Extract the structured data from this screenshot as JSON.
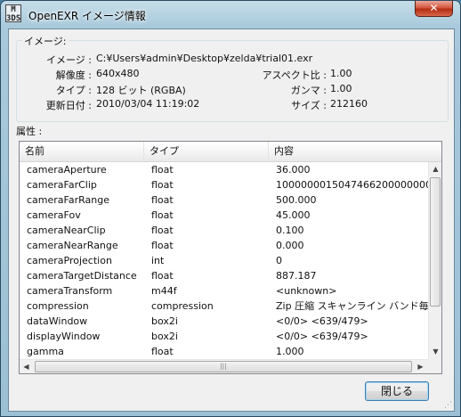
{
  "window": {
    "title": "OpenEXR イメージ情報",
    "icon_text": "M\n3DS",
    "close_glyph": "✕"
  },
  "image_group": {
    "legend": "イメージ:",
    "image_label": "イメージ :",
    "image_value": "C:¥Users¥admin¥Desktop¥zelda¥trial01.exr",
    "resolution_label": "解像度 :",
    "resolution_value": "640x480",
    "type_label": "タイプ :",
    "type_value": "128 ビット (RGBA)",
    "updated_label": "更新日付 :",
    "updated_value": "2010/03/04 11:19:02",
    "aspect_label": "アスペクト比 :",
    "aspect_value": "1.00",
    "gamma_label": "ガンマ :",
    "gamma_value": "1.00",
    "size_label": "サイズ :",
    "size_value": "212160"
  },
  "attributes": {
    "label": "属性 :",
    "columns": [
      "名前",
      "タイプ",
      "内容"
    ],
    "rows": [
      [
        "cameraAperture",
        "float",
        "36.000"
      ],
      [
        "cameraFarClip",
        "float",
        "10000000150474662000000000..."
      ],
      [
        "cameraFarRange",
        "float",
        "500.000"
      ],
      [
        "cameraFov",
        "float",
        "45.000"
      ],
      [
        "cameraNearClip",
        "float",
        "0.100"
      ],
      [
        "cameraNearRange",
        "float",
        "0.000"
      ],
      [
        "cameraProjection",
        "int",
        "0"
      ],
      [
        "cameraTargetDistance",
        "float",
        "887.187"
      ],
      [
        "cameraTransform",
        "m44f",
        "<unknown>"
      ],
      [
        "compression",
        "compression",
        "Zip 圧縮 スキャンライン バンド毎 (..."
      ],
      [
        "dataWindow",
        "box2i",
        "<0/0> <639/479>"
      ],
      [
        "displayWindow",
        "box2i",
        "<0/0> <639/479>"
      ],
      [
        "gamma",
        "float",
        "1.000"
      ]
    ]
  },
  "buttons": {
    "close_label": "閉じる"
  }
}
